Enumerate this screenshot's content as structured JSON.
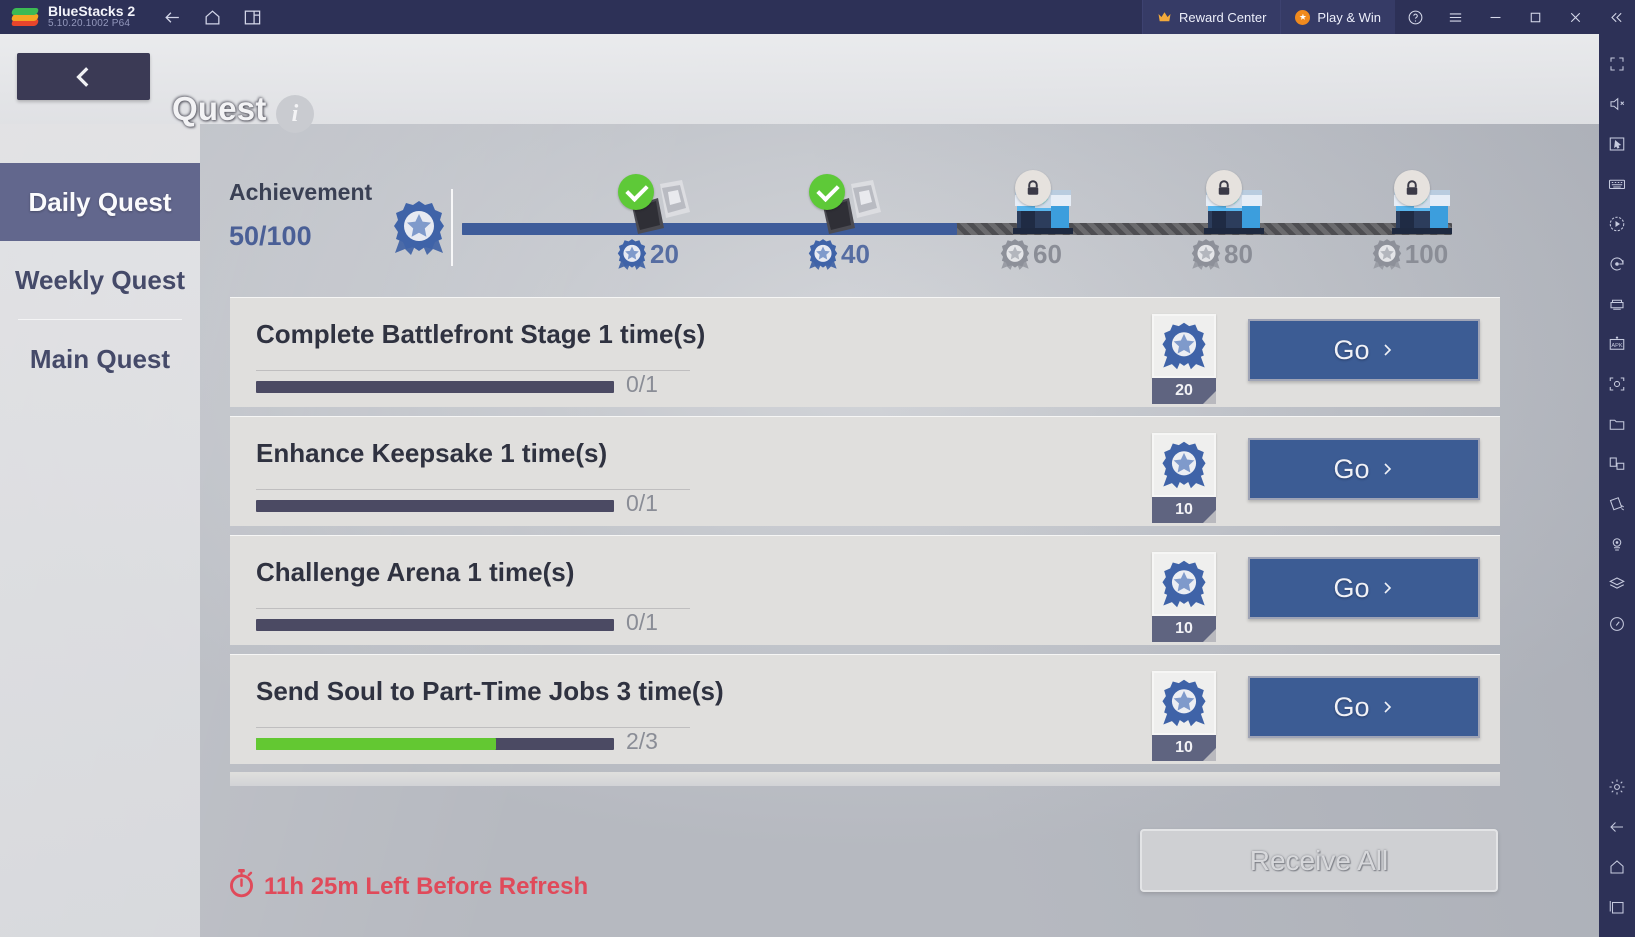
{
  "titlebar": {
    "app_name": "BlueStacks 2",
    "version": "5.10.20.1002  P64",
    "nav": [
      {
        "name": "back-arrow-icon",
        "label": "Back"
      },
      {
        "name": "home-icon",
        "label": "Home"
      },
      {
        "name": "multi-instance-icon",
        "label": "Multi-instance"
      }
    ],
    "reward_center": "Reward Center",
    "play_and_win": "Play & Win",
    "window_controls": [
      "help-icon",
      "menu-icon",
      "minimize-icon",
      "maximize-icon",
      "close-icon",
      "collapse-icon"
    ]
  },
  "right_toolbar": {
    "icons": [
      "fullscreen-icon",
      "mute-icon",
      "cursor-icon",
      "keyboard-controls-icon",
      "macro-play-icon",
      "macro-record-icon",
      "game-controls-icon",
      "install-apk-icon",
      "screenshot-icon",
      "media-folder-icon",
      "rotate-screen-icon",
      "tilt-icon",
      "location-icon",
      "layers-icon",
      "performance-icon",
      "settings-gear-icon",
      "back-icon",
      "home-icon",
      "recents-icon"
    ]
  },
  "game": {
    "header": {
      "back_button": "back-chevron",
      "title": "Quest",
      "info_label": "i"
    },
    "tabs": [
      {
        "label": "Daily Quest",
        "active": true
      },
      {
        "label": "Weekly Quest",
        "active": false
      },
      {
        "label": "Main Quest",
        "active": false
      }
    ],
    "achievement": {
      "label": "Achievement",
      "count": "50/100",
      "current": 50,
      "max": 100,
      "fill_percent": 50,
      "milestones": [
        {
          "value": "20",
          "state": "claimed"
        },
        {
          "value": "40",
          "state": "claimed"
        },
        {
          "value": "60",
          "state": "locked"
        },
        {
          "value": "80",
          "state": "locked"
        },
        {
          "value": "100",
          "state": "locked"
        }
      ]
    },
    "quests": [
      {
        "title": "Complete Battlefront Stage 1 time(s)",
        "progress_text": "0/1",
        "progress_percent": 0,
        "reward_qty": "20",
        "action": "Go"
      },
      {
        "title": "Enhance Keepsake 1 time(s)",
        "progress_text": "0/1",
        "progress_percent": 0,
        "reward_qty": "10",
        "action": "Go"
      },
      {
        "title": "Challenge Arena 1 time(s)",
        "progress_text": "0/1",
        "progress_percent": 0,
        "reward_qty": "10",
        "action": "Go"
      },
      {
        "title": "Send Soul to Part-Time Jobs 3 time(s)",
        "progress_text": "2/3",
        "progress_percent": 67,
        "reward_qty": "10",
        "action": "Go"
      }
    ],
    "footer": {
      "timer_text": "11h 25m Left Before Refresh",
      "receive_all": "Receive All"
    }
  },
  "colors": {
    "accent_blue": "#3c5c94",
    "track_fill": "#3e5c9a",
    "progress_green": "#63c832",
    "timer_red": "#e04a5a",
    "tab_active": "#62678d",
    "chrome": "#2d3157"
  }
}
